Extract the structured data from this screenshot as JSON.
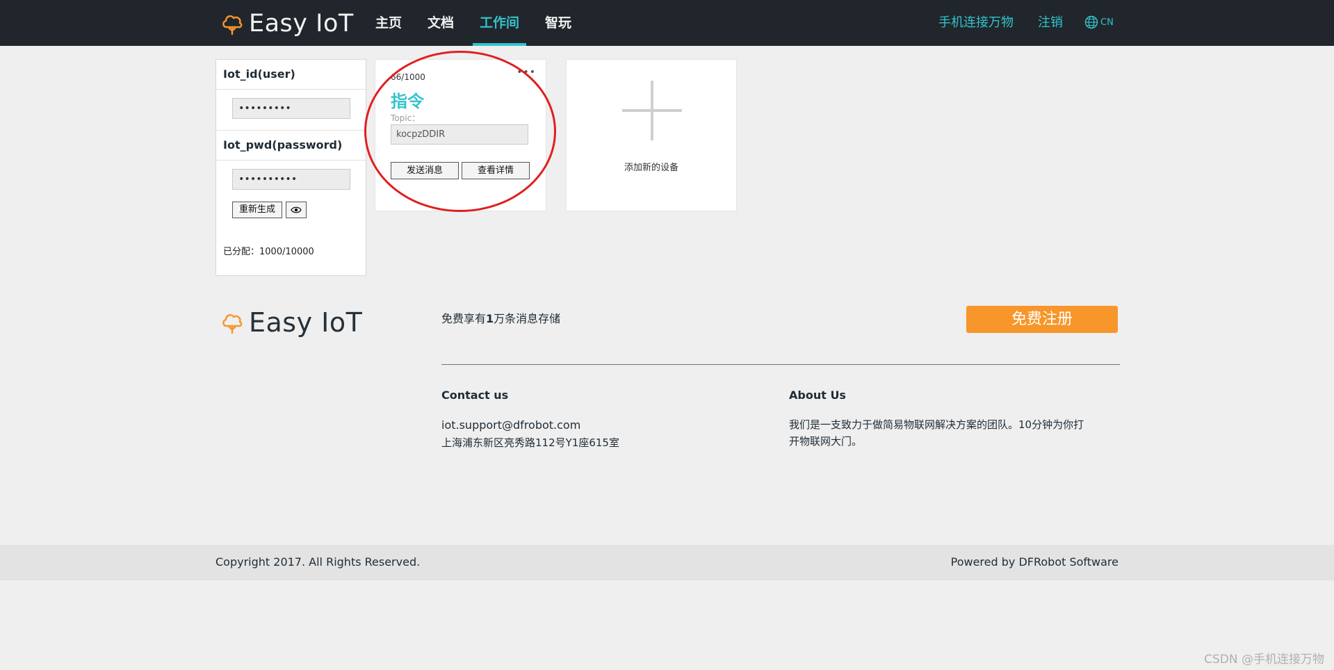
{
  "brand": {
    "name": "Easy IoT",
    "accent": "#33c3cc",
    "logo_color": "#f7962a"
  },
  "nav": {
    "links": [
      {
        "label": "主页"
      },
      {
        "label": "文档"
      },
      {
        "label": "工作间",
        "active": true
      },
      {
        "label": "智玩"
      }
    ],
    "right_link": "手机连接万物",
    "logout": "注销",
    "language": "CN"
  },
  "sidebar": {
    "id_label": "Iot_id(user)",
    "id_value": "•••••••••",
    "pwd_label": "Iot_pwd(password)",
    "pwd_value": "••••••••••",
    "regenerate_label": "重新生成",
    "assigned": "已分配：1000/10000"
  },
  "device_card": {
    "count": "66/1000",
    "menu": "•••",
    "name": "指令",
    "topic_label": "Topic：",
    "topic_value": "kocpzDDIR",
    "send_label": "发送消息",
    "detail_label": "查看详情"
  },
  "add_device": {
    "label": "添加新的设备"
  },
  "footer": {
    "storage_text_pre": "免费享有",
    "storage_text_bold": "1",
    "storage_text_post": "万条消息存储",
    "register_label": "免费注册",
    "contact_title": "Contact us",
    "contact_email": "iot.support@dfrobot.com",
    "contact_address": "上海浦东新区亮秀路112号Y1座615室",
    "about_title": "About Us",
    "about_text_line1": "我们是一支致力于做简易物联网解决方案的团队。10分钟为你打",
    "about_text_line2": "开物联网大门。",
    "copyright": "Copyright 2017. All Rights Reserved.",
    "powered": "Powered by DFRobot Software"
  },
  "watermark": "CSDN @手机连接万物"
}
